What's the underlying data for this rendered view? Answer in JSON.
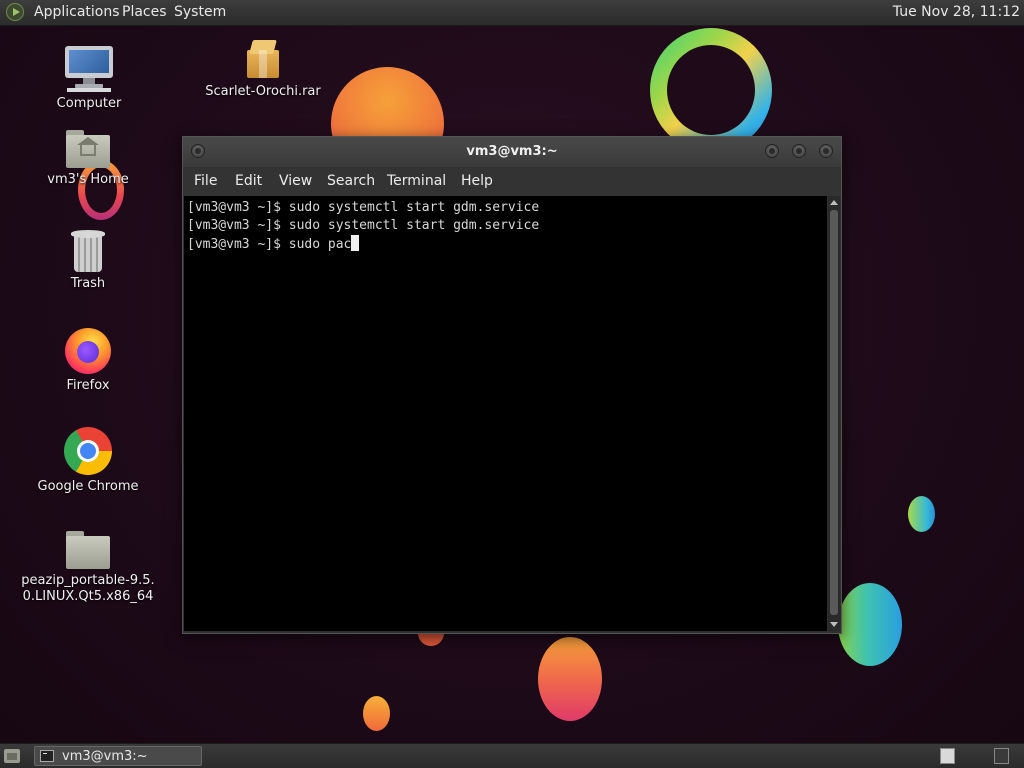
{
  "top_panel": {
    "menus": [
      "Applications",
      "Places",
      "System"
    ],
    "clock": "Tue Nov 28, 11:12"
  },
  "desktop_icons": [
    {
      "label": "Computer",
      "icon": "computer-icon"
    },
    {
      "label": "Scarlet-Orochi.rar",
      "icon": "archive-icon"
    },
    {
      "label": "vm3's Home",
      "icon": "home-folder-icon"
    },
    {
      "label": "Trash",
      "icon": "trash-icon"
    },
    {
      "label": "Firefox",
      "icon": "firefox-icon"
    },
    {
      "label": "Google Chrome",
      "icon": "chrome-icon"
    },
    {
      "label": "peazip_portable-9.5.\n0.LINUX.Qt5.x86_64",
      "icon": "folder-icon"
    }
  ],
  "terminal": {
    "title": "vm3@vm3:~",
    "menu": [
      "File",
      "Edit",
      "View",
      "Search",
      "Terminal",
      "Help"
    ],
    "lines": [
      "[vm3@vm3 ~]$ sudo systemctl start gdm.service",
      "[vm3@vm3 ~]$ sudo systemctl start gdm.service",
      "[vm3@vm3 ~]$ sudo pac"
    ]
  },
  "taskbar": {
    "window_label": "vm3@vm3:~"
  },
  "colors": {
    "background": "#1e0a19",
    "panel": "#333333",
    "terminal_bg": "#000000",
    "terminal_fg": "#d8d8d8"
  }
}
